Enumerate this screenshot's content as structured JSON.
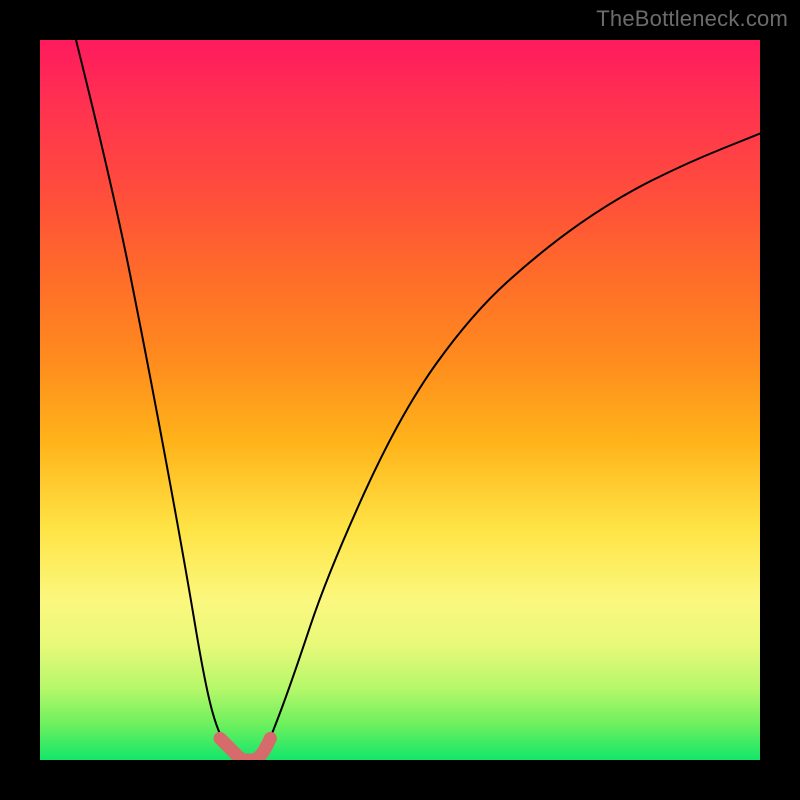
{
  "watermark": "TheBottleneck.com",
  "chart_data": {
    "type": "line",
    "title": "",
    "xlabel": "",
    "ylabel": "",
    "xlim": [
      0,
      100
    ],
    "ylim": [
      0,
      100
    ],
    "grid": false,
    "legend": false,
    "series": [
      {
        "name": "bottleneck-curve",
        "x": [
          5,
          10,
          15,
          20,
          23,
          25,
          27,
          28,
          29,
          30,
          31,
          32,
          35,
          40,
          50,
          60,
          70,
          80,
          90,
          100
        ],
        "y": [
          100,
          80,
          55,
          28,
          10,
          3,
          1,
          0,
          0,
          0,
          1,
          3,
          11,
          26,
          48,
          62,
          71,
          78,
          83,
          87
        ]
      }
    ],
    "annotations": [
      {
        "name": "notch-highlight",
        "x_range": [
          24,
          33
        ],
        "color": "#d76a6a"
      }
    ],
    "background_gradient": {
      "stops": [
        {
          "pos": 0.0,
          "hex": "#ff1a5e"
        },
        {
          "pos": 0.2,
          "hex": "#ff4a3e"
        },
        {
          "pos": 0.44,
          "hex": "#ff8a1e"
        },
        {
          "pos": 0.68,
          "hex": "#ffe446"
        },
        {
          "pos": 0.9,
          "hex": "#b6f86a"
        },
        {
          "pos": 1.0,
          "hex": "#12e66a"
        }
      ]
    }
  }
}
